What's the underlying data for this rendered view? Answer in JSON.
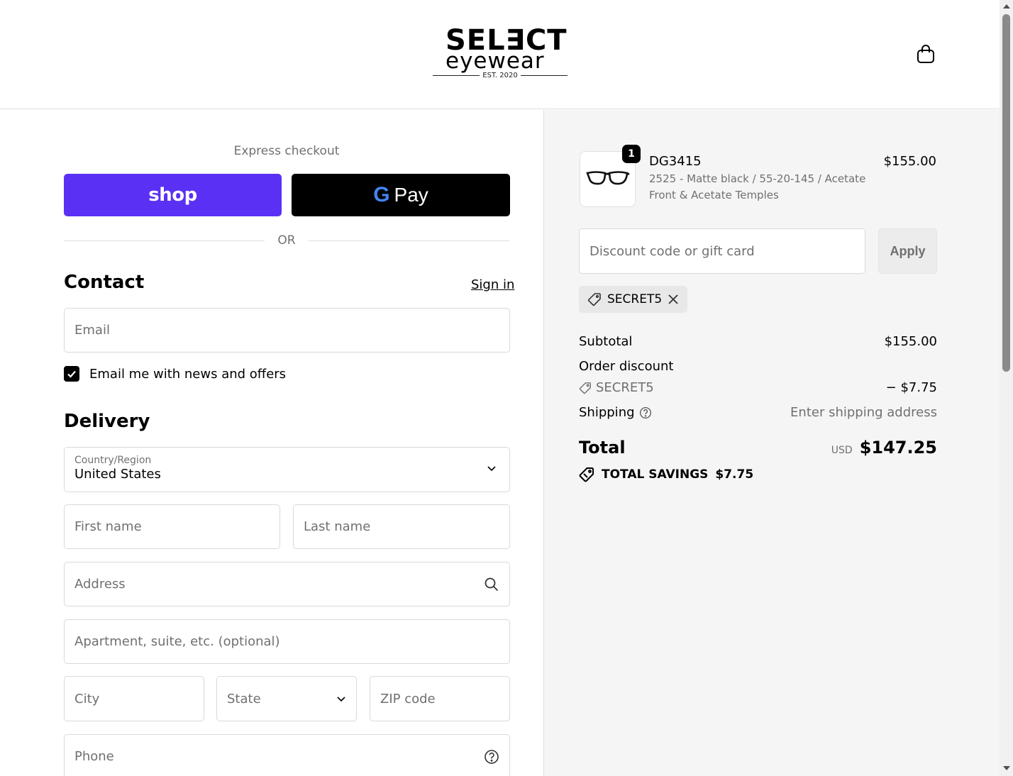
{
  "header": {
    "logo_top": "SEL∃CT",
    "logo_bottom": "eyewear",
    "logo_est": "EST. 2020"
  },
  "express": {
    "title": "Express checkout",
    "shop_label": "shop",
    "gpay_g": "G",
    "gpay_label": "Pay",
    "or_label": "OR"
  },
  "contact": {
    "title": "Contact",
    "sign_in": "Sign in",
    "email_placeholder": "Email",
    "newsletter_label": "Email me with news and offers",
    "newsletter_checked": true
  },
  "delivery": {
    "title": "Delivery",
    "country_label": "Country/Region",
    "country_value": "United States",
    "first_name_placeholder": "First name",
    "last_name_placeholder": "Last name",
    "address_placeholder": "Address",
    "apartment_placeholder": "Apartment, suite, etc. (optional)",
    "city_placeholder": "City",
    "state_placeholder": "State",
    "zip_placeholder": "ZIP code",
    "phone_placeholder": "Phone"
  },
  "order": {
    "item": {
      "quantity": "1",
      "name": "DG3415",
      "variant": "2525 - Matte black / 55-20-145 / Acetate Front & Acetate Temples",
      "price": "$155.00"
    },
    "discount_placeholder": "Discount code or gift card",
    "apply_label": "Apply",
    "applied_code": "SECRET5",
    "subtotal_label": "Subtotal",
    "subtotal_value": "$155.00",
    "order_discount_label": "Order discount",
    "discount_code": "SECRET5",
    "discount_value": "− $7.75",
    "shipping_label": "Shipping",
    "shipping_value": "Enter shipping address",
    "total_label": "Total",
    "total_currency": "USD",
    "total_value": "$147.25",
    "savings_label": "TOTAL SAVINGS",
    "savings_value": "$7.75"
  },
  "colors": {
    "shop_pay": "#5a31f4",
    "gpay": "#000000",
    "summary_bg": "#f5f5f5"
  }
}
